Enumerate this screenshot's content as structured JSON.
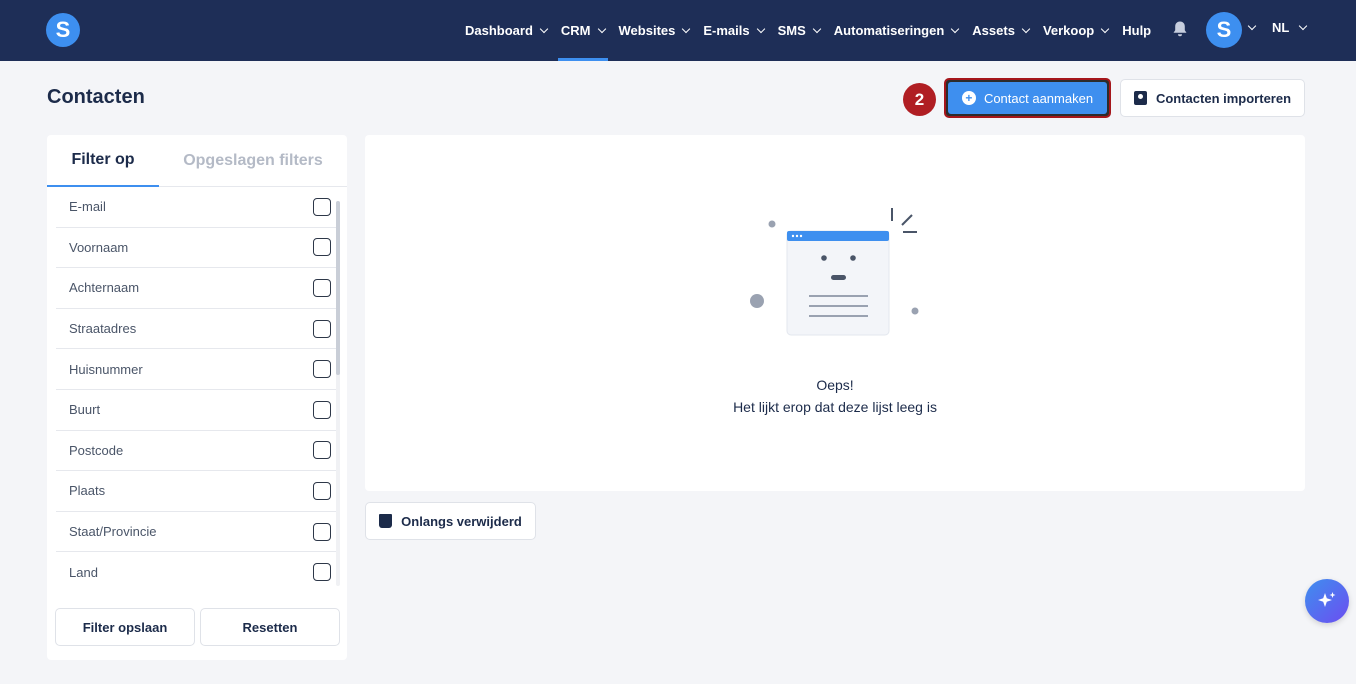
{
  "brand": {
    "logo_letter": "S"
  },
  "nav": {
    "items": [
      {
        "label": "Dashboard",
        "has_dropdown": true,
        "active": false
      },
      {
        "label": "CRM",
        "has_dropdown": true,
        "active": true
      },
      {
        "label": "Websites",
        "has_dropdown": true,
        "active": false
      },
      {
        "label": "E-mails",
        "has_dropdown": true,
        "active": false
      },
      {
        "label": "SMS",
        "has_dropdown": true,
        "active": false
      },
      {
        "label": "Automatiseringen",
        "has_dropdown": true,
        "active": false
      },
      {
        "label": "Assets",
        "has_dropdown": true,
        "active": false
      },
      {
        "label": "Verkoop",
        "has_dropdown": true,
        "active": false
      },
      {
        "label": "Hulp",
        "has_dropdown": false,
        "active": false
      }
    ],
    "notifications_icon": "bell-icon",
    "avatar_letter": "S",
    "language": "NL"
  },
  "page": {
    "title": "Contacten",
    "step_badge": "2",
    "create_button": "Contact aanmaken",
    "import_button": "Contacten importeren"
  },
  "filters": {
    "tabs": [
      "Filter op",
      "Opgeslagen filters"
    ],
    "active_tab": "Filter op",
    "fields": [
      "E-mail",
      "Voornaam",
      "Achternaam",
      "Straatadres",
      "Huisnummer",
      "Buurt",
      "Postcode",
      "Plaats",
      "Staat/Provincie",
      "Land"
    ],
    "save_button": "Filter opslaan",
    "reset_button": "Resetten"
  },
  "empty_state": {
    "title": "Oeps!",
    "message": "Het lijkt erop dat deze lijst leeg is"
  },
  "recently_deleted_button": "Onlangs verwijderd",
  "colors": {
    "nav_background": "#1e2e57",
    "accent": "#3e8fef",
    "highlight_border": "#a5161b",
    "step_badge": "#b01e23"
  }
}
